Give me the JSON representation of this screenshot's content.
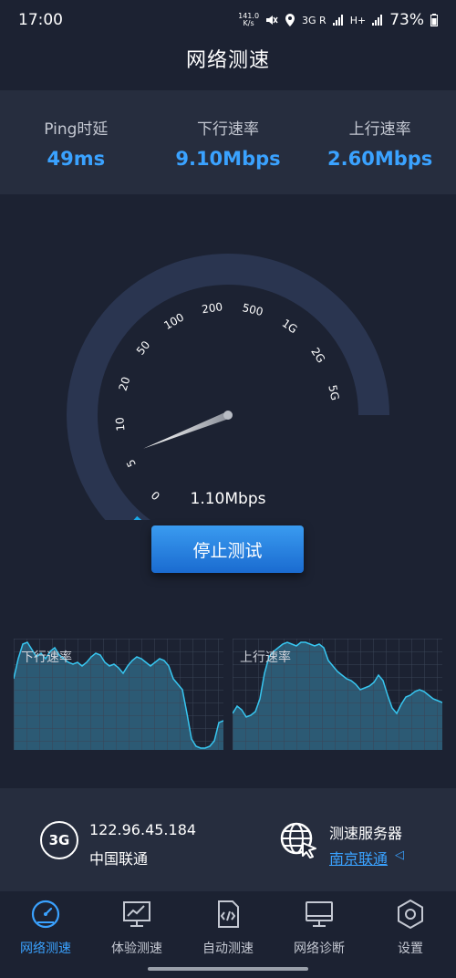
{
  "status_bar": {
    "time": "17:00",
    "net_speed_value": "141.0",
    "net_speed_unit": "K/s",
    "sim_tag_1": "3G R",
    "sim_tag_2": "H+",
    "battery": "73%"
  },
  "header": {
    "title": "网络测速"
  },
  "stats": [
    {
      "label": "Ping时延",
      "value": "49ms"
    },
    {
      "label": "下行速率",
      "value": "9.10Mbps"
    },
    {
      "label": "上行速率",
      "value": "2.60Mbps"
    }
  ],
  "gauge": {
    "ticks": [
      "0",
      "5",
      "10",
      "20",
      "50",
      "100",
      "200",
      "500",
      "1G",
      "2G",
      "5G"
    ],
    "current_speed": "1.10Mbps",
    "needle_fraction": 0.16,
    "accent": "#1aa8e8"
  },
  "stop_button": {
    "label": "停止测试"
  },
  "graphs": {
    "download_label": "下行速率",
    "upload_label": "上行速率"
  },
  "info": {
    "network_badge": "3G",
    "ip": "122.96.45.184",
    "carrier": "中国联通",
    "server_title": "测速服务器",
    "server_name": "南京联通",
    "server_arrow": "◁"
  },
  "tabs": [
    {
      "label": "网络测速",
      "icon": "speedometer-icon",
      "active": true
    },
    {
      "label": "体验测速",
      "icon": "monitor-chart-icon",
      "active": false
    },
    {
      "label": "自动测速",
      "icon": "code-file-icon",
      "active": false
    },
    {
      "label": "网络诊断",
      "icon": "desktop-icon",
      "active": false
    },
    {
      "label": "设置",
      "icon": "gear-hexagon-icon",
      "active": false
    }
  ],
  "colors": {
    "background": "#1c2232",
    "panel": "#262d3e",
    "accent": "#3aa2ff",
    "graph_line": "#37c6f0"
  }
}
